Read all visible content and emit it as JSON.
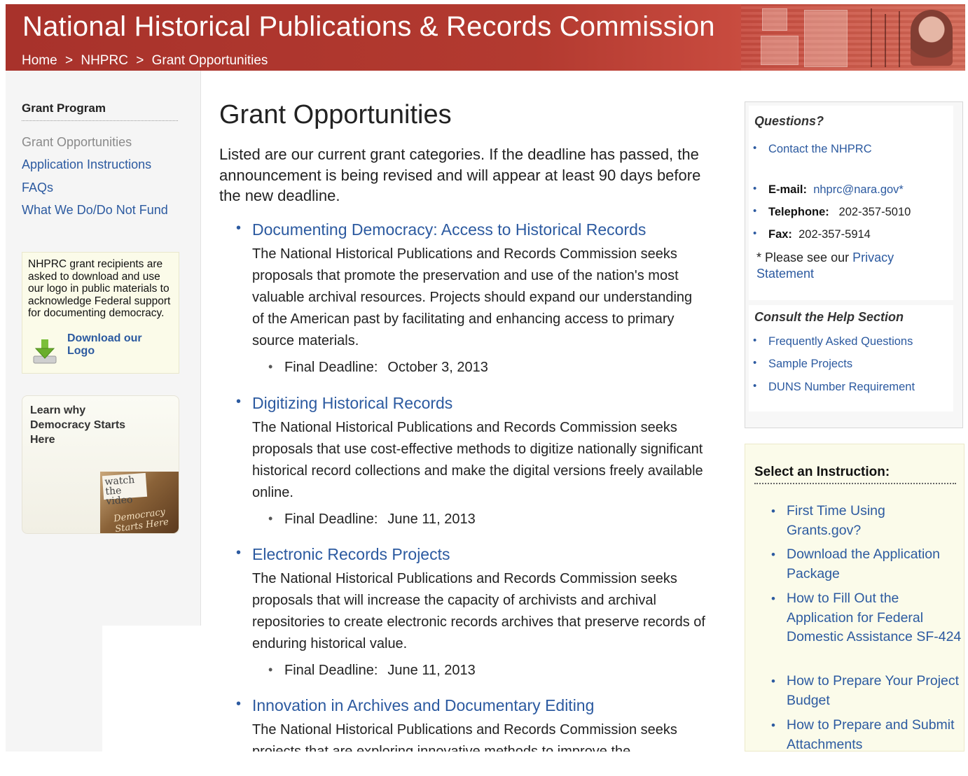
{
  "header": {
    "title": "National Historical Publications & Records Commission",
    "breadcrumb": [
      "Home",
      ">",
      "NHPRC",
      ">",
      "Grant Opportunities"
    ]
  },
  "sidebar": {
    "heading": "Grant Program",
    "items": [
      {
        "label": "Grant Opportunities",
        "current": true
      },
      {
        "label": "Application Instructions",
        "current": false
      },
      {
        "label": "FAQs",
        "current": false
      },
      {
        "label": "What We Do/Do Not Fund",
        "current": false
      }
    ],
    "logo_box": {
      "text": "NHPRC grant recipients are asked to download and use our logo in public materials to acknowledge Federal support for documenting democracy.",
      "download_label": "Download our Logo",
      "icon": "download-arrow-icon"
    },
    "video_box": {
      "text": "Learn why Democracy Starts Here",
      "thumb_watch": "watch the video",
      "thumb_tag": "Democracy Starts Here"
    }
  },
  "main": {
    "title": "Grant Opportunities",
    "intro": "Listed are our current grant categories. If the deadline has passed, the announcement is being revised and will appear at least 90 days before the new deadline.",
    "categories": [
      {
        "title": "Documenting Democracy: Access to Historical Records",
        "description": "The National Historical Publications and Records Commission seeks proposals that promote the preservation and use of the nation's most valuable archival resources. Projects should expand our understanding of the American past by facilitating and enhancing access to primary source materials.",
        "deadline_label": "Final Deadline:",
        "deadline": "October 3, 2013"
      },
      {
        "title": "Digitizing Historical Records",
        "description": "The National Historical Publications and Records Commission seeks proposals that use cost-effective methods to digitize nationally significant historical record collections and make the digital versions freely available online.",
        "deadline_label": "Final Deadline:",
        "deadline": "June 11, 2013"
      },
      {
        "title": "Electronic Records Projects",
        "description": "The National Historical Publications and Records Commission seeks proposals that will increase the capacity of archivists and archival repositories to create electronic records archives that preserve records of enduring historical value.",
        "deadline_label": "Final Deadline:",
        "deadline": "June 11, 2013"
      },
      {
        "title": "Innovation in Archives and Documentary Editing",
        "description": "The National Historical Publications and Records Commission seeks projects that are exploring innovative methods to improve the"
      }
    ]
  },
  "right": {
    "questions": {
      "heading": "Questions?",
      "contact_label": "Contact the NHPRC",
      "email_label": "E-mail:",
      "email": "nhprc@nara.gov*",
      "phone_label": "Telephone:",
      "phone": "202-357-5010",
      "fax_label": "Fax:",
      "fax": "202-357-5914",
      "privacy_prefix": "* Please see our",
      "privacy_link": "Privacy Statement"
    },
    "help": {
      "heading": "Consult the Help Section",
      "items": [
        "Frequently Asked Questions",
        "Sample Projects",
        "DUNS Number Requirement"
      ]
    },
    "instructions": {
      "heading": "Select an Instruction:",
      "items": [
        "First Time Using Grants.gov?",
        "Download the Application Package",
        "How to Fill Out the Application for Federal Domestic Assistance SF-424",
        "How to Prepare Your Project Budget",
        "How to Prepare and Submit Attachments"
      ]
    }
  },
  "colors": {
    "header_red": "#a8322b",
    "link_blue": "#2c5aa0",
    "sidebar_bg": "#f5f5f5",
    "note_bg": "#fbfbea"
  }
}
